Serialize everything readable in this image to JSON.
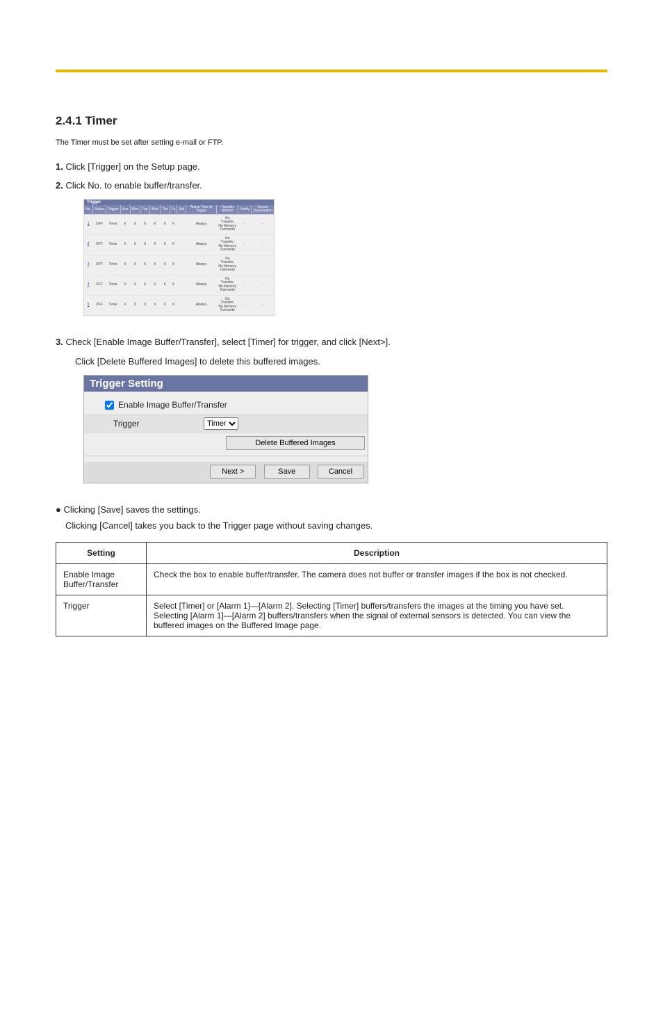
{
  "heading1": "2.4.1 Timer",
  "heading_sub": "The Timer must be set after setting e-mail or FTP.",
  "step1_lead": "1.",
  "step1_text": "Click [Trigger] on the Setup page.",
  "step2_lead": "2.",
  "step2_text": "Click No. to enable buffer/transfer.",
  "step3_lead": "3.",
  "step3_text": "Check [Enable Image Buffer/Transfer], select [Timer] for trigger, and click [Next>].",
  "step3_note": "Click [Delete Buffered Images] to delete this buffered images.",
  "trigger": {
    "title": "Trigger",
    "headers": [
      "No.",
      "Status",
      "Trigger",
      "Sun",
      "Mon",
      "Tue",
      "Wed",
      "Thu",
      "Fri",
      "Sat",
      "Active Time of Trigger",
      "Transfer Method",
      "Notify",
      "Sensor Deactivation"
    ],
    "rows": [
      {
        "no": "1",
        "status": "OFF",
        "trigger": "Timer",
        "sun": "X",
        "mon": "X",
        "tue": "X",
        "wed": "X",
        "thu": "X",
        "fri": "X",
        "sat": "",
        "active": "Always",
        "transfer": "No Transfer, No Memory Overwrite",
        "notify": "-",
        "sensor": "-"
      },
      {
        "no": "2",
        "status": "OFF",
        "trigger": "Timer",
        "sun": "X",
        "mon": "X",
        "tue": "X",
        "wed": "X",
        "thu": "X",
        "fri": "X",
        "sat": "",
        "active": "Always",
        "transfer": "No Transfer, No Memory Overwrite",
        "notify": "-",
        "sensor": "-"
      },
      {
        "no": "3",
        "status": "OFF",
        "trigger": "Timer",
        "sun": "X",
        "mon": "X",
        "tue": "X",
        "wed": "X",
        "thu": "X",
        "fri": "X",
        "sat": "",
        "active": "Always",
        "transfer": "No Transfer, No Memory Overwrite",
        "notify": "-",
        "sensor": "-"
      },
      {
        "no": "4",
        "status": "OFF",
        "trigger": "Timer",
        "sun": "X",
        "mon": "X",
        "tue": "X",
        "wed": "X",
        "thu": "X",
        "fri": "X",
        "sat": "",
        "active": "Always",
        "transfer": "No Transfer, No Memory Overwrite",
        "notify": "-",
        "sensor": "-"
      },
      {
        "no": "5",
        "status": "OFF",
        "trigger": "Timer",
        "sun": "X",
        "mon": "X",
        "tue": "X",
        "wed": "X",
        "thu": "X",
        "fri": "X",
        "sat": "",
        "active": "Always",
        "transfer": "No Transfer, No Memory Overwrite",
        "notify": "-",
        "sensor": "-"
      }
    ]
  },
  "dlg": {
    "title": "Trigger Setting",
    "check_label": "Enable Image Buffer/Transfer",
    "trigger_label": "Trigger",
    "trigger_options": [
      "Timer"
    ],
    "trigger_selected": "Timer",
    "delete_label": "Delete Buffered Images",
    "next_label": "Next >",
    "save_label": "Save",
    "cancel_label": "Cancel"
  },
  "desc": {
    "lead_bullet": "● Clicking [Save] saves the settings.",
    "lead": "Clicking [Cancel] takes you back to the Trigger page without saving changes.",
    "head_setting": "Setting",
    "head_desc": "Description",
    "rows": [
      {
        "setting": "Enable Image Buffer/Transfer",
        "desc": "Check the box to enable buffer/transfer. The camera does not buffer or transfer images if the box is not checked."
      },
      {
        "setting": "Trigger",
        "desc": "Select [Timer] or [Alarm 1]—[Alarm 2]. Selecting [Timer] buffers/transfers the images at the timing you have set. Selecting [Alarm 1]—[Alarm 2] buffers/transfers when the signal of external sensors is detected. You can view the buffered images on the Buffered Image page."
      }
    ]
  }
}
